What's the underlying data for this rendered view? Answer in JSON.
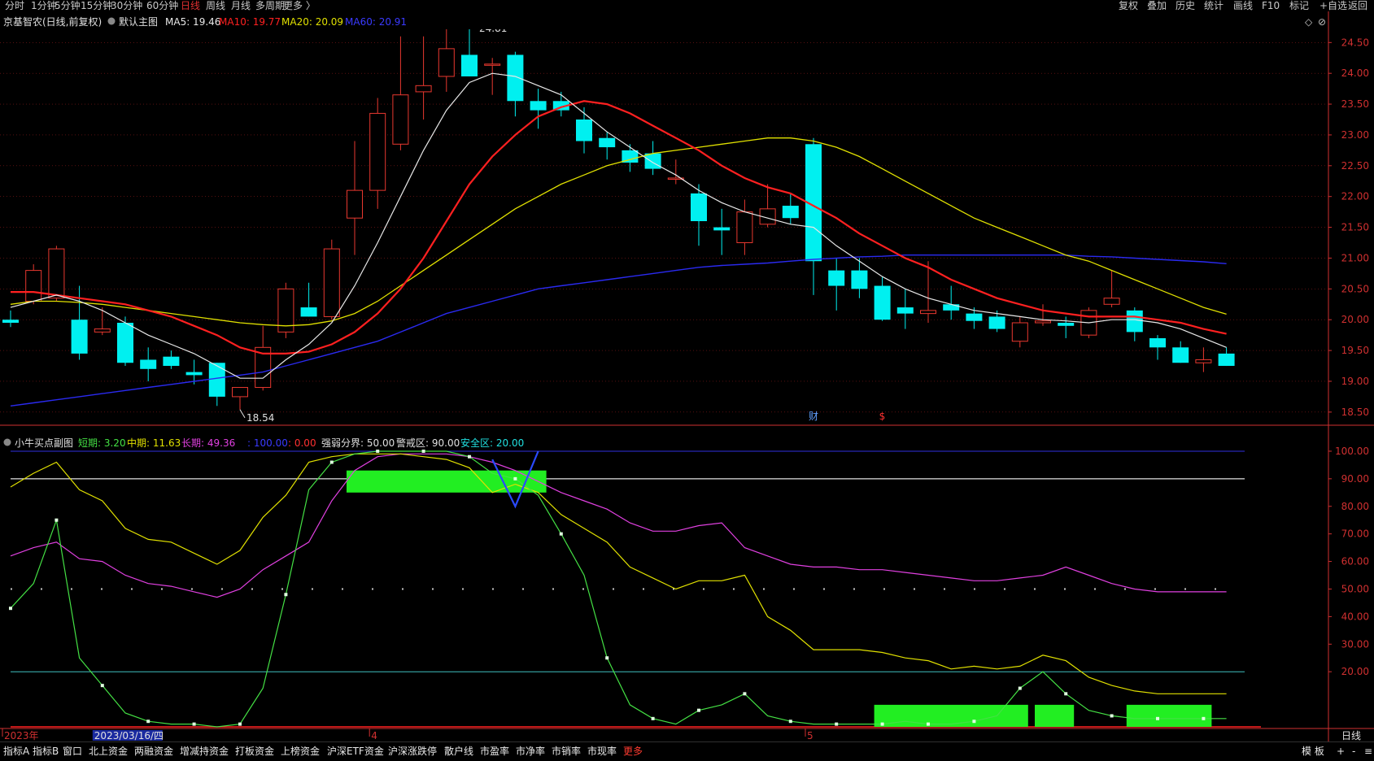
{
  "toolbar": {
    "left_items": [
      "分时",
      "1分钟",
      "5分钟",
      "15分钟",
      "30分钟",
      "60分钟",
      "日线",
      "周线",
      "月线",
      "多周期",
      "更多 〉"
    ],
    "active": "日线",
    "right_items": [
      "复权",
      "叠加",
      "历史",
      "统计",
      "画线",
      "F10",
      "标记",
      "+自选",
      "返回"
    ]
  },
  "bottom": {
    "tabs": [
      "指标A",
      "指标B",
      "窗口",
      "北上资金",
      "两融资金",
      "增减持资金",
      "打板资金",
      "上榜资金",
      "沪深ETF资金",
      "沪深涨跌停",
      "散户线",
      "市盈率",
      "市净率",
      "市销率",
      "市现率",
      "更多"
    ],
    "highlight": "更多",
    "right_items": [
      "模 板",
      "+",
      "-",
      "≡"
    ]
  },
  "main_panel": {
    "stock": "京基智农(日线,前复权)",
    "indicator_name": "默认主图",
    "ma_labels": [
      "MA5: 19.46",
      "MA10: 19.77",
      "MA20: 20.09",
      "MA60: 20.91"
    ],
    "high_mark": "24.81",
    "low_mark": "18.54",
    "event_marks": [
      "财",
      "$"
    ]
  },
  "sub_panel": {
    "name": "小牛买点副图",
    "labels": [
      "短期: 3.20",
      "中期: 11.63",
      "长期: 49.36",
      ": 100.00",
      ": 0.00",
      "强弱分界: 50.00",
      "警戒区: 90.00",
      "安全区: 20.00"
    ]
  },
  "colors": {
    "up": "#e8382f",
    "down": "#00f0f0",
    "ma5": "#e8e8e8",
    "ma10": "#ff2020",
    "ma20": "#e0e000",
    "ma60": "#2a2af0",
    "short": "#44e044",
    "mid": "#e0e000",
    "long": "#e040e0",
    "green_block": "#22ee22",
    "grid": "#8a1a1a",
    "axis": "#d03030"
  },
  "chart_data": [
    {
      "type": "candlestick",
      "title": "京基智农(日线,前复权)",
      "y_ticks": [
        18.5,
        19.0,
        19.5,
        20.0,
        20.5,
        21.0,
        21.5,
        22.0,
        22.5,
        23.0,
        23.5,
        24.0,
        24.5
      ],
      "ylim": [
        18.3,
        24.9
      ],
      "x_labels": [
        {
          "i": 0,
          "text": "2023年"
        },
        {
          "i": 4,
          "text": "2023/03/16/四"
        },
        {
          "i": 16,
          "text": "4"
        },
        {
          "i": 35,
          "text": "5"
        }
      ],
      "period_label": "日线",
      "candles": [
        {
          "o": 20.0,
          "h": 20.15,
          "l": 19.88,
          "c": 19.95
        },
        {
          "o": 20.3,
          "h": 20.9,
          "l": 20.25,
          "c": 20.8
        },
        {
          "o": 20.35,
          "h": 21.2,
          "l": 20.3,
          "c": 21.15
        },
        {
          "o": 20.0,
          "h": 20.55,
          "l": 19.35,
          "c": 19.45
        },
        {
          "o": 19.8,
          "h": 20.2,
          "l": 19.75,
          "c": 19.85
        },
        {
          "o": 19.95,
          "h": 20.05,
          "l": 19.25,
          "c": 19.3
        },
        {
          "o": 19.35,
          "h": 19.55,
          "l": 19.0,
          "c": 19.2
        },
        {
          "o": 19.4,
          "h": 19.5,
          "l": 19.2,
          "c": 19.25
        },
        {
          "o": 19.15,
          "h": 19.35,
          "l": 18.95,
          "c": 19.1
        },
        {
          "o": 19.3,
          "h": 19.3,
          "l": 18.6,
          "c": 18.75
        },
        {
          "o": 18.75,
          "h": 18.9,
          "l": 18.54,
          "c": 18.9
        },
        {
          "o": 18.9,
          "h": 19.9,
          "l": 18.85,
          "c": 19.55
        },
        {
          "o": 19.8,
          "h": 20.6,
          "l": 19.7,
          "c": 20.5
        },
        {
          "o": 20.2,
          "h": 20.6,
          "l": 20.05,
          "c": 20.05
        },
        {
          "o": 20.05,
          "h": 21.3,
          "l": 20.0,
          "c": 21.15
        },
        {
          "o": 21.65,
          "h": 22.9,
          "l": 21.05,
          "c": 22.1
        },
        {
          "o": 22.1,
          "h": 23.6,
          "l": 21.8,
          "c": 23.35
        },
        {
          "o": 22.85,
          "h": 24.6,
          "l": 22.75,
          "c": 23.65
        },
        {
          "o": 23.7,
          "h": 24.6,
          "l": 23.25,
          "c": 23.8
        },
        {
          "o": 23.95,
          "h": 24.75,
          "l": 23.7,
          "c": 24.4
        },
        {
          "o": 24.3,
          "h": 24.81,
          "l": 23.95,
          "c": 23.95
        },
        {
          "o": 24.15,
          "h": 24.25,
          "l": 23.65,
          "c": 24.15
        },
        {
          "o": 24.3,
          "h": 24.35,
          "l": 23.3,
          "c": 23.55
        },
        {
          "o": 23.55,
          "h": 23.75,
          "l": 23.1,
          "c": 23.4
        },
        {
          "o": 23.55,
          "h": 23.7,
          "l": 23.3,
          "c": 23.4
        },
        {
          "o": 23.25,
          "h": 23.45,
          "l": 22.7,
          "c": 22.9
        },
        {
          "o": 22.95,
          "h": 23.05,
          "l": 22.6,
          "c": 22.8
        },
        {
          "o": 22.75,
          "h": 22.85,
          "l": 22.4,
          "c": 22.55
        },
        {
          "o": 22.7,
          "h": 22.9,
          "l": 22.35,
          "c": 22.45
        },
        {
          "o": 22.3,
          "h": 22.6,
          "l": 22.2,
          "c": 22.3
        },
        {
          "o": 22.05,
          "h": 22.2,
          "l": 21.2,
          "c": 21.6
        },
        {
          "o": 21.5,
          "h": 21.8,
          "l": 21.05,
          "c": 21.45
        },
        {
          "o": 21.25,
          "h": 21.95,
          "l": 21.05,
          "c": 21.75
        },
        {
          "o": 21.55,
          "h": 22.2,
          "l": 21.5,
          "c": 21.8
        },
        {
          "o": 21.85,
          "h": 22.05,
          "l": 21.55,
          "c": 21.65
        },
        {
          "o": 22.85,
          "h": 22.95,
          "l": 20.4,
          "c": 20.95
        },
        {
          "o": 20.8,
          "h": 21.0,
          "l": 20.15,
          "c": 20.55
        },
        {
          "o": 20.8,
          "h": 21.0,
          "l": 20.35,
          "c": 20.5
        },
        {
          "o": 20.55,
          "h": 20.7,
          "l": 19.98,
          "c": 20.0
        },
        {
          "o": 20.2,
          "h": 20.5,
          "l": 19.85,
          "c": 20.1
        },
        {
          "o": 20.1,
          "h": 20.95,
          "l": 19.95,
          "c": 20.15
        },
        {
          "o": 20.25,
          "h": 20.55,
          "l": 20.0,
          "c": 20.15
        },
        {
          "o": 20.1,
          "h": 20.2,
          "l": 19.85,
          "c": 19.98
        },
        {
          "o": 20.05,
          "h": 20.15,
          "l": 19.8,
          "c": 19.85
        },
        {
          "o": 19.65,
          "h": 20.05,
          "l": 19.55,
          "c": 19.95
        },
        {
          "o": 19.95,
          "h": 20.25,
          "l": 19.9,
          "c": 19.98
        },
        {
          "o": 19.95,
          "h": 20.05,
          "l": 19.7,
          "c": 19.9
        },
        {
          "o": 19.75,
          "h": 20.2,
          "l": 19.7,
          "c": 20.15
        },
        {
          "o": 20.25,
          "h": 20.8,
          "l": 20.2,
          "c": 20.35
        },
        {
          "o": 20.15,
          "h": 20.2,
          "l": 19.65,
          "c": 19.8
        },
        {
          "o": 19.7,
          "h": 19.75,
          "l": 19.35,
          "c": 19.55
        },
        {
          "o": 19.55,
          "h": 19.65,
          "l": 19.3,
          "c": 19.3
        },
        {
          "o": 19.3,
          "h": 19.55,
          "l": 19.15,
          "c": 19.35
        },
        {
          "o": 19.45,
          "h": 19.55,
          "l": 19.25,
          "c": 19.25
        }
      ],
      "ma5": [
        20.2,
        20.3,
        20.4,
        20.3,
        20.15,
        19.95,
        19.75,
        19.6,
        19.45,
        19.25,
        19.05,
        19.05,
        19.35,
        19.6,
        19.95,
        20.55,
        21.25,
        22.0,
        22.75,
        23.4,
        23.85,
        24.0,
        23.95,
        23.8,
        23.65,
        23.35,
        23.05,
        22.8,
        22.55,
        22.35,
        22.1,
        21.9,
        21.75,
        21.65,
        21.55,
        21.5,
        21.2,
        20.95,
        20.7,
        20.5,
        20.35,
        20.25,
        20.15,
        20.1,
        20.05,
        20.0,
        19.98,
        19.95,
        20.0,
        20.0,
        19.95,
        19.85,
        19.7,
        19.55
      ],
      "ma10": [
        20.45,
        20.45,
        20.4,
        20.35,
        20.3,
        20.25,
        20.15,
        20.05,
        19.9,
        19.75,
        19.55,
        19.45,
        19.45,
        19.48,
        19.6,
        19.8,
        20.1,
        20.5,
        21.0,
        21.6,
        22.2,
        22.65,
        23.0,
        23.3,
        23.45,
        23.55,
        23.5,
        23.35,
        23.15,
        22.95,
        22.75,
        22.5,
        22.3,
        22.15,
        22.05,
        21.85,
        21.65,
        21.4,
        21.2,
        21.0,
        20.85,
        20.65,
        20.5,
        20.35,
        20.25,
        20.15,
        20.1,
        20.05,
        20.05,
        20.05,
        20.0,
        19.95,
        19.85,
        19.77
      ],
      "ma20": [
        20.25,
        20.3,
        20.3,
        20.28,
        20.25,
        20.2,
        20.15,
        20.1,
        20.05,
        20.0,
        19.95,
        19.92,
        19.9,
        19.92,
        19.98,
        20.1,
        20.3,
        20.55,
        20.8,
        21.05,
        21.3,
        21.55,
        21.8,
        22.0,
        22.2,
        22.35,
        22.5,
        22.6,
        22.7,
        22.75,
        22.8,
        22.85,
        22.9,
        22.95,
        22.95,
        22.9,
        22.8,
        22.65,
        22.45,
        22.25,
        22.05,
        21.85,
        21.65,
        21.5,
        21.35,
        21.2,
        21.05,
        20.95,
        20.8,
        20.65,
        20.5,
        20.35,
        20.2,
        20.09
      ],
      "ma60": [
        18.6,
        18.65,
        18.7,
        18.75,
        18.8,
        18.85,
        18.9,
        18.95,
        19.0,
        19.05,
        19.1,
        19.15,
        19.25,
        19.35,
        19.45,
        19.55,
        19.65,
        19.8,
        19.95,
        20.1,
        20.2,
        20.3,
        20.4,
        20.5,
        20.55,
        20.6,
        20.65,
        20.7,
        20.75,
        20.8,
        20.85,
        20.88,
        20.9,
        20.92,
        20.95,
        20.98,
        21.0,
        21.02,
        21.03,
        21.05,
        21.05,
        21.05,
        21.05,
        21.05,
        21.05,
        21.05,
        21.05,
        21.03,
        21.02,
        21.0,
        20.98,
        20.96,
        20.94,
        20.91
      ]
    },
    {
      "type": "line",
      "title": "小牛买点副图",
      "y_ticks": [
        20,
        30,
        40,
        50,
        60,
        70,
        80,
        90,
        100
      ],
      "ylim": [
        0,
        105
      ],
      "hlines": [
        100,
        90,
        50,
        20,
        0
      ],
      "series": [
        {
          "name": "短期",
          "values": [
            43,
            52,
            75,
            25,
            15,
            5,
            2,
            1,
            1,
            0,
            1,
            14,
            48,
            86,
            96,
            99,
            100,
            100,
            100,
            100,
            98,
            92,
            90,
            84,
            70,
            55,
            25,
            8,
            3,
            1,
            6,
            8,
            12,
            4,
            2,
            1,
            1,
            1,
            1,
            2,
            1,
            1,
            2,
            4,
            14,
            20,
            12,
            6,
            4,
            3,
            3,
            3,
            3,
            3
          ]
        },
        {
          "name": "中期",
          "values": [
            87,
            92,
            96,
            86,
            82,
            72,
            68,
            67,
            63,
            59,
            64,
            76,
            84,
            96,
            98,
            99,
            99,
            99,
            98,
            97,
            94,
            85,
            88,
            85,
            77,
            72,
            67,
            58,
            54,
            50,
            53,
            53,
            55,
            40,
            35,
            28,
            28,
            28,
            27,
            25,
            24,
            21,
            22,
            21,
            22,
            26,
            24,
            18,
            15,
            13,
            12,
            12,
            12,
            12
          ]
        },
        {
          "name": "长期",
          "values": [
            62,
            65,
            67,
            61,
            60,
            55,
            52,
            51,
            49,
            47,
            50,
            57,
            62,
            67,
            82,
            93,
            98,
            99,
            99,
            99,
            98,
            96,
            93,
            89,
            85,
            82,
            79,
            74,
            71,
            71,
            73,
            74,
            65,
            62,
            59,
            58,
            58,
            57,
            57,
            56,
            55,
            54,
            53,
            53,
            54,
            55,
            58,
            55,
            52,
            50,
            49,
            49,
            49,
            49
          ]
        }
      ],
      "green_blocks": [
        {
          "from": 15,
          "to": 23,
          "bottom": 85,
          "top": 93
        },
        {
          "from": 38,
          "to": 44,
          "bottom": 0,
          "top": 8
        },
        {
          "from": 45,
          "to": 46,
          "bottom": 0,
          "top": 8
        },
        {
          "from": 49,
          "to": 52,
          "bottom": 0,
          "top": 8
        }
      ],
      "blue_v": [
        {
          "i": 21,
          "v": 97
        },
        {
          "i": 22,
          "v": 80
        },
        {
          "i": 23,
          "v": 100
        }
      ]
    }
  ]
}
